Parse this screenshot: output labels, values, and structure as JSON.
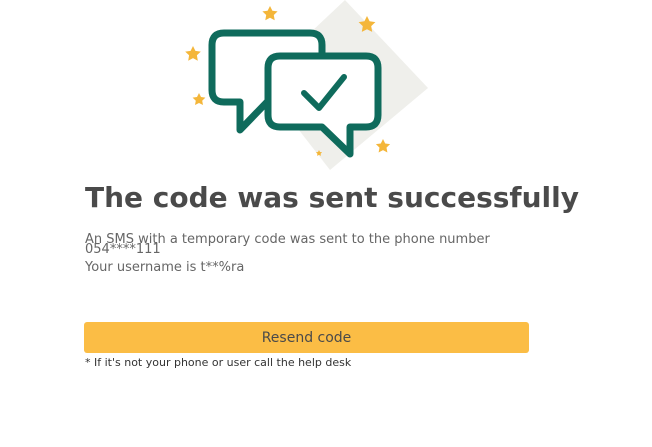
{
  "page": {
    "title": "The code was sent successfully",
    "sms_message": "An SMS with a temporary code was sent to the phone number",
    "phone_number": "054****111",
    "username_message": "Your username is t**%ra",
    "resend_button_label": "Resend code",
    "help_note": "* If it's not your phone or user call the help desk"
  },
  "illustration": {
    "icon": "chat-bubbles-check-icon",
    "primary_color": "#0f6b5c",
    "star_color": "#f4b63a",
    "backdrop_color": "#efefeb"
  }
}
